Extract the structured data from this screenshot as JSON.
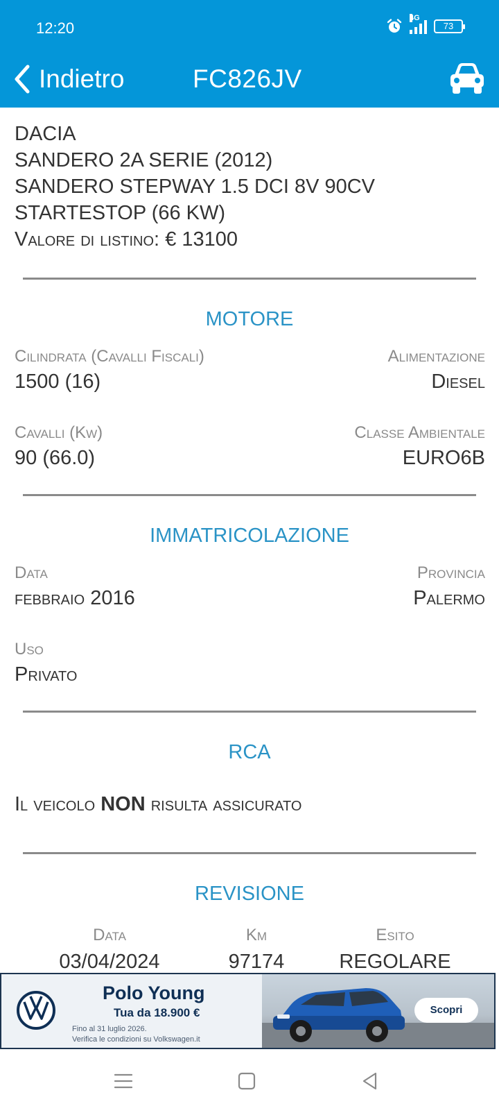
{
  "status_bar": {
    "time": "12:20",
    "network": "4G",
    "battery": "73",
    "icons": [
      "alarm-icon",
      "signal-icon",
      "battery-icon"
    ]
  },
  "app_bar": {
    "back_label": "Indietro",
    "title": "FC826JV",
    "back_icon": "chevron-left-icon",
    "action_icon": "car-icon",
    "color": "#0496d9"
  },
  "vehicle": {
    "make": "DACIA",
    "series": "SANDERO 2A SERIE (2012)",
    "version_line1": "SANDERO STEPWAY 1.5 DCI 8V 90CV",
    "version_line2": "STARTESTOP (66 KW)",
    "list_price_label": "Valore di listino:",
    "list_price_value": "€ 13100"
  },
  "sections": {
    "motore": {
      "title": "MOTORE",
      "cilindrata_label": "Cilindrata (Cavalli Fiscali)",
      "cilindrata_value": "1500 (16)",
      "alimentazione_label": "Alimentazione",
      "alimentazione_value": "Diesel",
      "cavalli_label": "Cavalli (Kw)",
      "cavalli_value": "90 (66.0)",
      "classe_label": "Classe Ambientale",
      "classe_value": "EURO6B"
    },
    "immatricolazione": {
      "title": "IMMATRICOLAZIONE",
      "data_label": "Data",
      "data_value": "febbraio 2016",
      "provincia_label": "Provincia",
      "provincia_value": "Palermo",
      "uso_label": "Uso",
      "uso_value": "Privato"
    },
    "rca": {
      "title": "RCA",
      "text_before": "Il veicolo ",
      "text_bold": "NON",
      "text_after": " risulta assicurato"
    },
    "revisione": {
      "title": "REVISIONE",
      "columns": [
        {
          "label": "Data",
          "value": "03/04/2024"
        },
        {
          "label": "Km",
          "value": "97174"
        },
        {
          "label": "Esito",
          "value": "REGOLARE"
        }
      ]
    }
  },
  "ad": {
    "title": "Polo Young",
    "price": "Tua da 18.900 €",
    "fine_line1": "Fino al 31 luglio 2026.",
    "fine_line2": "Verifica le condizioni su Volkswagen.it",
    "cta": "Scopri",
    "logo_icon": "vw-logo-icon",
    "car_icon": "car-photo",
    "brand_color": "#0f2f55"
  },
  "nav_bar": {
    "icons": [
      "menu-icon",
      "home-square-icon",
      "back-triangle-icon"
    ]
  }
}
